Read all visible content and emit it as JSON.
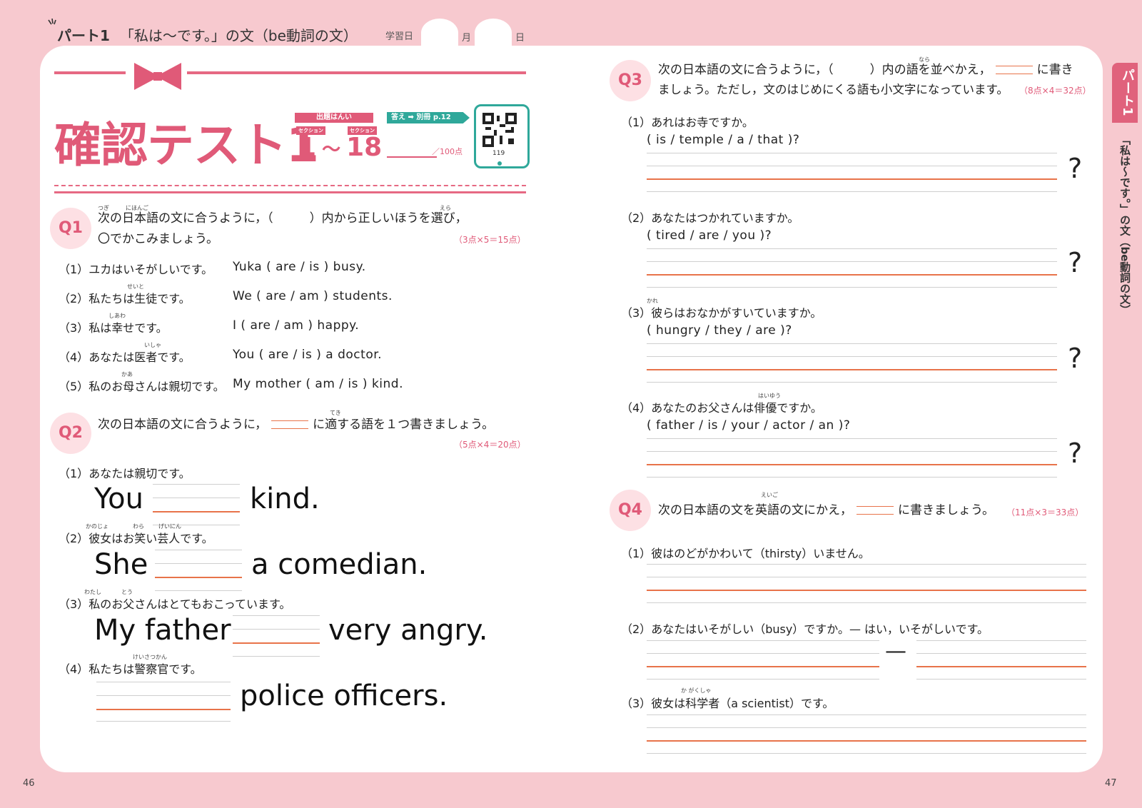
{
  "header": {
    "part": "パート1",
    "title": "「私は〜です。」の文（be動詞の文）",
    "study_date": "学習日",
    "month": "月",
    "day": "日"
  },
  "side_tab": {
    "part": "パート1",
    "title": "「私は〜です。」の文（be動詞の文）"
  },
  "page_numbers": {
    "left": "46",
    "right": "47"
  },
  "test": {
    "title": "確認テスト1",
    "range_label": "出題はんい",
    "section_tag": "セクション",
    "range_from": "1",
    "range_sep": "〜",
    "range_to": "18",
    "answer_tag": "答え ➡ 別冊 p.12",
    "score_total": "／100点",
    "qr_number": "119"
  },
  "q1": {
    "badge": "Q1",
    "furigana": [
      "つぎ",
      "にほんご",
      "えら"
    ],
    "line1": "次の日本語の文に合うように，（　　　）内から正しいほうを選び，",
    "line2": "〇でかこみましょう。",
    "points": "（3点×5＝15点）",
    "items": [
      {
        "num": "（1）",
        "ja": "ユカはいそがしいです。",
        "en": "Yuka ( are / is ) busy."
      },
      {
        "num": "（2）",
        "ja": "私たちは生徒です。",
        "en": "We ( are / am ) students.",
        "furi": "せいと"
      },
      {
        "num": "（3）",
        "ja": "私は幸せです。",
        "en": "I ( are / am ) happy.",
        "furi": "しあわ"
      },
      {
        "num": "（4）",
        "ja": "あなたは医者です。",
        "en": "You ( are / is ) a doctor.",
        "furi": "いしゃ"
      },
      {
        "num": "（5）",
        "ja": "私のお母さんは親切です。",
        "en": "My mother ( am / is ) kind.",
        "furi": "かあ"
      }
    ]
  },
  "q2": {
    "badge": "Q2",
    "furigana": "てき",
    "text_before": "次の日本語の文に合うように，",
    "text_after": "に適する語を１つ書きましょう。",
    "points": "（5点×4＝20点）",
    "items": [
      {
        "num": "（1）",
        "ja": "あなたは親切です。",
        "pre": "You",
        "post": "kind."
      },
      {
        "num": "（2）",
        "ja": "彼女はお笑い芸人です。",
        "furi": [
          "かのじょ",
          "わら",
          "げいにん"
        ],
        "pre": "She",
        "post": "a comedian."
      },
      {
        "num": "（3）",
        "ja": "私のお父さんはとてもおこっています。",
        "furi": [
          "わたし",
          "とう"
        ],
        "pre": "My father",
        "post": "very angry."
      },
      {
        "num": "（4）",
        "ja": "私たちは警察官です。",
        "furi": [
          "けいさつかん"
        ],
        "pre": "",
        "post": "police officers."
      }
    ]
  },
  "q3": {
    "badge": "Q3",
    "furigana": "なら",
    "line1a": "次の日本語の文に合うように，（　　　）内の語を並べかえ，",
    "line1b": "に書き",
    "line2": "ましょう。ただし，文のはじめにくる語も小文字になっています。",
    "points": "（8点×4＝32点）",
    "items": [
      {
        "num": "（1）",
        "ja": "あれはお寺ですか。",
        "en": "( is / temple / a / that )?",
        "q": "?"
      },
      {
        "num": "（2）",
        "ja": "あなたはつかれていますか。",
        "en": "( tired / are / you )?",
        "q": "?"
      },
      {
        "num": "（3）",
        "ja": "彼らはおなかがすいていますか。",
        "furi": "かれ",
        "en": "( hungry / they / are )?",
        "q": "?"
      },
      {
        "num": "（4）",
        "ja": "あなたのお父さんは俳優ですか。",
        "furi": "はいゆう",
        "en": "( father / is / your / actor / an )?",
        "q": "?"
      }
    ]
  },
  "q4": {
    "badge": "Q4",
    "furigana": "えいご",
    "text_before": "次の日本語の文を英語の文にかえ，",
    "text_after": "に書きましょう。",
    "points": "（11点×3＝33点）",
    "items": [
      {
        "num": "（1）",
        "ja": "彼はのどがかわいて（thirsty）いません。"
      },
      {
        "num": "（2）",
        "ja": "あなたはいそがしい（busy）ですか。— はい，いそがしいです。",
        "dash": "—"
      },
      {
        "num": "（3）",
        "ja": "彼女は科学者（a scientist）です。",
        "furi": "か がくしゃ"
      }
    ]
  }
}
